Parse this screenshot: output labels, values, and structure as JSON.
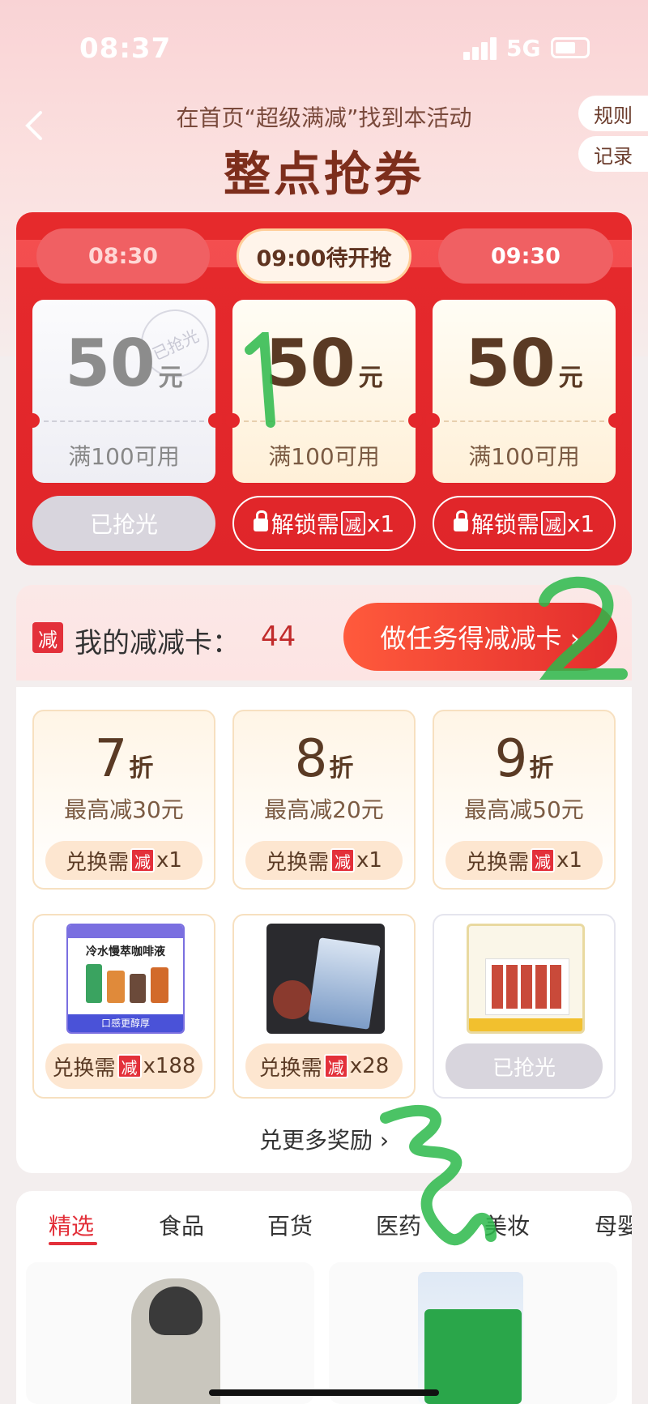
{
  "status_bar": {
    "time": "08:37",
    "network": "5G"
  },
  "header": {
    "hint": "在首页“超级满减”找到本活动",
    "title": "整点抢券",
    "rules_label": "规则",
    "record_label": "记录"
  },
  "time_slots": [
    "08:30",
    "09:00待开抢",
    "09:30"
  ],
  "coupons": [
    {
      "amount": "50",
      "unit": "元",
      "condition": "满100可用",
      "stamp": "已抢光",
      "button": "已抢光"
    },
    {
      "amount": "50",
      "unit": "元",
      "condition": "满100可用",
      "button_prefix": "解锁需",
      "button_icon": "减",
      "button_suffix": "x1"
    },
    {
      "amount": "50",
      "unit": "元",
      "condition": "满100可用",
      "button_prefix": "解锁需",
      "button_icon": "减",
      "button_suffix": "x1"
    }
  ],
  "card_bar": {
    "icon": "减",
    "label": "我的减减卡：",
    "count": "44",
    "task_button": "做任务得减减卡 ›"
  },
  "discounts": [
    {
      "value": "7",
      "unit": "折",
      "max": "最高减30元",
      "btn_prefix": "兑换需",
      "btn_icon": "减",
      "btn_suffix": "x1"
    },
    {
      "value": "8",
      "unit": "折",
      "max": "最高减20元",
      "btn_prefix": "兑换需",
      "btn_icon": "减",
      "btn_suffix": "x1"
    },
    {
      "value": "9",
      "unit": "折",
      "max": "最高减50元",
      "btn_prefix": "兑换需",
      "btn_icon": "减",
      "btn_suffix": "x1"
    }
  ],
  "products": [
    {
      "img_title": "冷水慢萃咖啡液",
      "img_tag": "口感更醇厚",
      "btn_prefix": "兑换需",
      "btn_icon": "减",
      "btn_suffix": "x188"
    },
    {
      "btn_prefix": "兑换需",
      "btn_icon": "减",
      "btn_suffix": "x28"
    },
    {
      "button": "已抢光"
    }
  ],
  "more_rewards": "兑更多奖励 ›",
  "category_tabs": [
    "精选",
    "食品",
    "百货",
    "医药",
    "美妆",
    "母婴"
  ],
  "colors": {
    "primary_red": "#e3303a",
    "panel_red": "#e62a2c",
    "brown": "#5a3a24",
    "annotation_green": "#2cb84a"
  }
}
